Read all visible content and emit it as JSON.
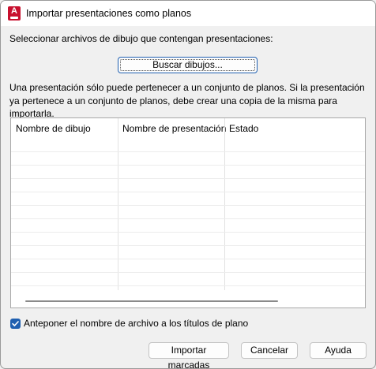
{
  "window": {
    "title": "Importar presentaciones como planos",
    "app_icon_letter": "A"
  },
  "instruction": "Seleccionar archivos de dibujo que contengan presentaciones:",
  "browse_button": "Buscar dibujos...",
  "description": "Una presentación sólo puede pertenecer a un conjunto de planos. Si la presentación ya pertenece a un conjunto de planos, debe crear una copia de la misma para importarla.",
  "table": {
    "columns": [
      "Nombre de dibujo",
      "Nombre de presentación",
      "Estado"
    ],
    "rows": []
  },
  "prefix_checkbox": {
    "label": "Anteponer el nombre de archivo a los títulos de plano",
    "checked": true
  },
  "buttons": {
    "import": "Importar marcadas",
    "cancel": "Cancelar",
    "help": "Ayuda"
  },
  "colors": {
    "accent": "#1f5fb0",
    "app_icon": "#c8102e"
  }
}
